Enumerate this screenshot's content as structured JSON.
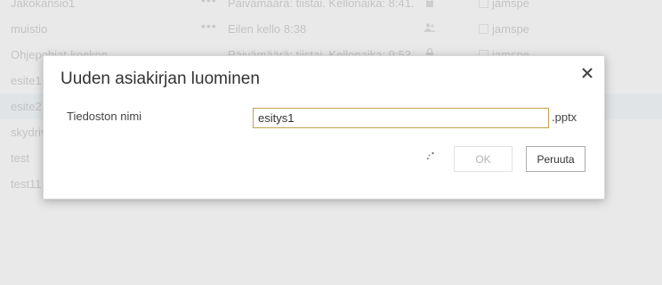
{
  "list": {
    "rows": [
      {
        "name": "Jakokansio1",
        "modified": "Päivämäärä: tiistai. Kellonaika: 8:41.",
        "share_icon": "lock-icon",
        "user": "jamspe",
        "has_menu": true
      },
      {
        "name": "muistio",
        "modified": "Eilen kello 8:38",
        "share_icon": "people-icon",
        "user": "jamspe",
        "has_menu": true
      },
      {
        "name": "Ohjepohjat-koekon",
        "modified": "Päivämäärä: tiistai. Kellonaika: 9:53.",
        "share_icon": "lock-icon",
        "user": "jamspe",
        "has_menu": false
      },
      {
        "name": "esite1",
        "modified": "",
        "share_icon": "",
        "user": "",
        "has_menu": false
      },
      {
        "name": "esite2",
        "modified": "",
        "share_icon": "",
        "user": "",
        "has_menu": false,
        "selected": true
      },
      {
        "name": "skydrive",
        "modified": "",
        "share_icon": "",
        "user": "",
        "has_menu": false
      },
      {
        "name": "test",
        "modified": "",
        "share_icon": "",
        "user": "",
        "has_menu": false
      },
      {
        "name": "test11",
        "modified": "",
        "share_icon": "",
        "user": "",
        "has_menu": false
      }
    ],
    "row_menu_glyph": "•••",
    "selected_color": "#cfe5f5"
  },
  "dialog": {
    "title": "Uuden asiakirjan luominen",
    "field_label": "Tiedoston nimi",
    "filename_value": "esitys1",
    "extension": ".pptx",
    "ok_label": "OK",
    "cancel_label": "Peruuta",
    "ok_enabled": false,
    "close_icon": "close-icon",
    "busy_icon": "spinner-icon",
    "input_border_color": "#c5a24a"
  }
}
